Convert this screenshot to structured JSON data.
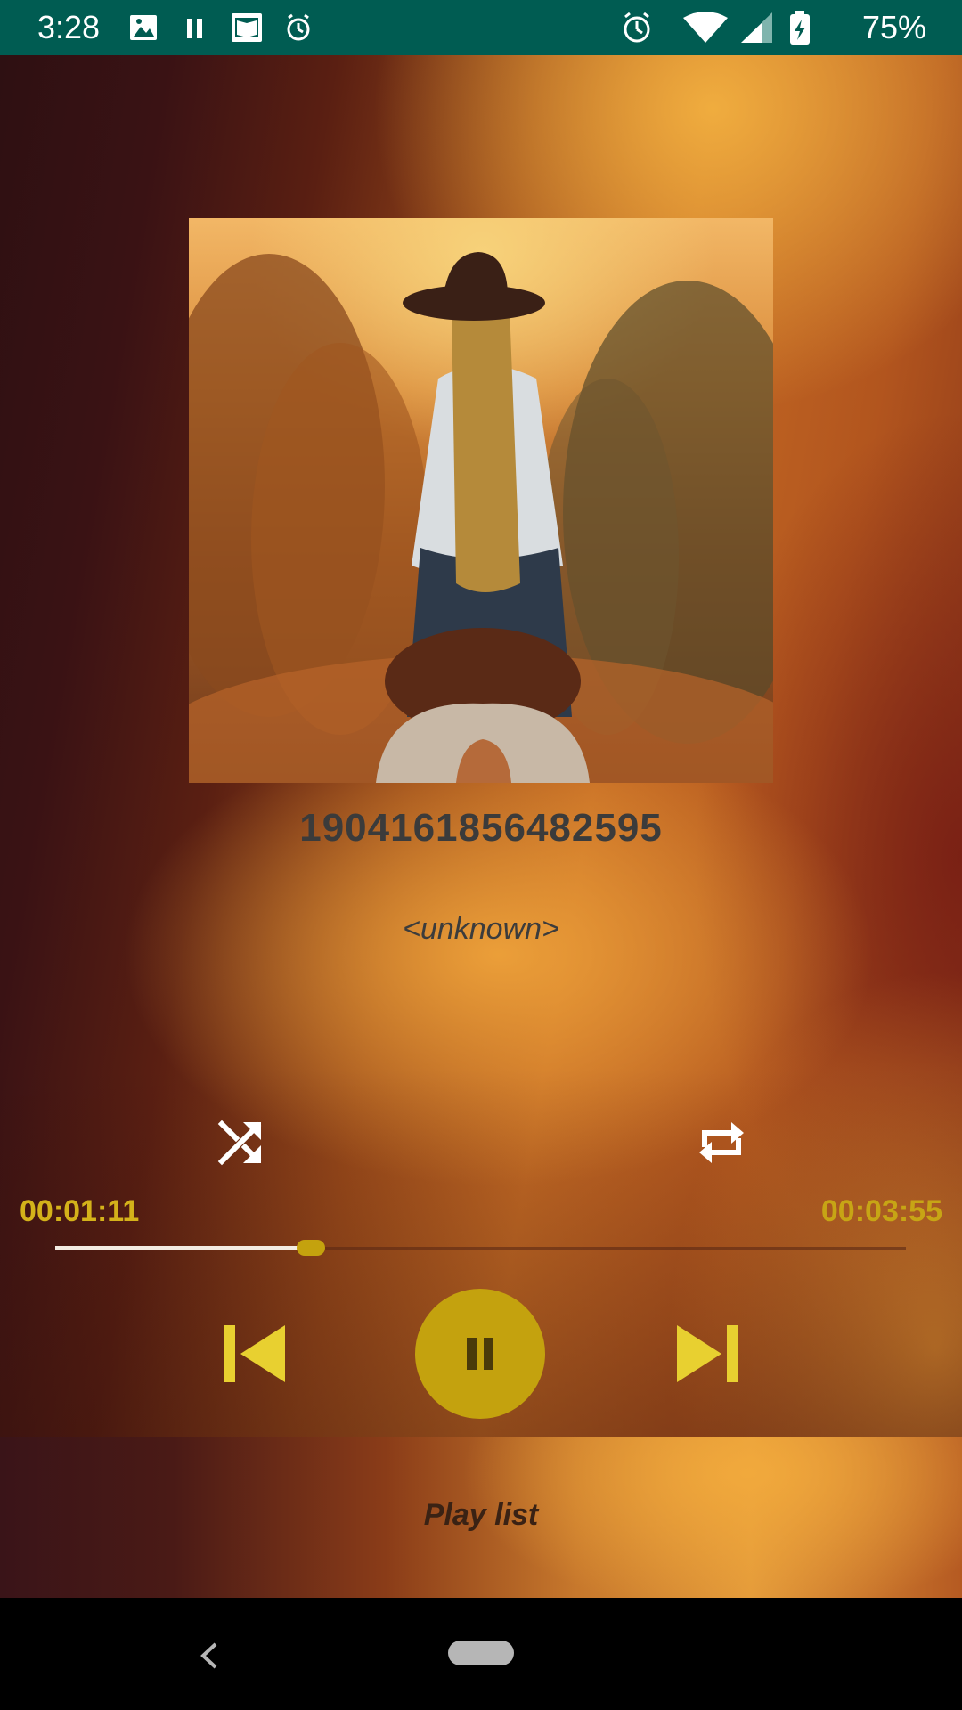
{
  "status_bar": {
    "time": "3:28",
    "battery_percent": "75%",
    "left_icons": [
      "image-icon",
      "pause-icon",
      "book-icon",
      "alarm-icon"
    ],
    "right_icons": [
      "alarm-icon",
      "wifi-icon",
      "signal-icon",
      "battery-charging-icon"
    ]
  },
  "player": {
    "title": "1904161856482595",
    "artist": "<unknown>",
    "current_time": "00:01:11",
    "total_time": "00:03:55",
    "progress_fraction": 0.3,
    "state": "playing"
  },
  "controls": {
    "shuffle_icon": "shuffle-icon",
    "repeat_icon": "repeat-icon",
    "previous_icon": "skip-previous-icon",
    "play_pause_icon": "pause-icon",
    "next_icon": "skip-next-icon"
  },
  "playlist": {
    "label": "Play list"
  },
  "colors": {
    "status_bar": "#005c52",
    "accent": "#c4a20e",
    "time_text": "#d4b21a",
    "nav_button": "#e8d030"
  }
}
